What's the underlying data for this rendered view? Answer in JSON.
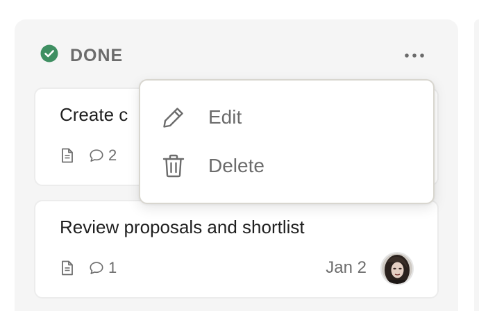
{
  "column": {
    "title": "DONE",
    "status_icon": "check-circle-icon",
    "more_icon": "more-horizontal-icon"
  },
  "cards": [
    {
      "title": "Create c",
      "doc_icon": "document-icon",
      "comment_icon": "comment-icon",
      "comment_count": "2"
    },
    {
      "title": "Review proposals and shortlist",
      "doc_icon": "document-icon",
      "comment_icon": "comment-icon",
      "comment_count": "1",
      "date": "Jan 2",
      "avatar": "avatar"
    }
  ],
  "menu": {
    "items": [
      {
        "label": "Edit",
        "icon": "pencil-icon"
      },
      {
        "label": "Delete",
        "icon": "trash-icon"
      }
    ]
  },
  "colors": {
    "status_green": "#3f8f62",
    "column_bg": "#f5f5f5",
    "text_muted": "#6b6b6b"
  }
}
